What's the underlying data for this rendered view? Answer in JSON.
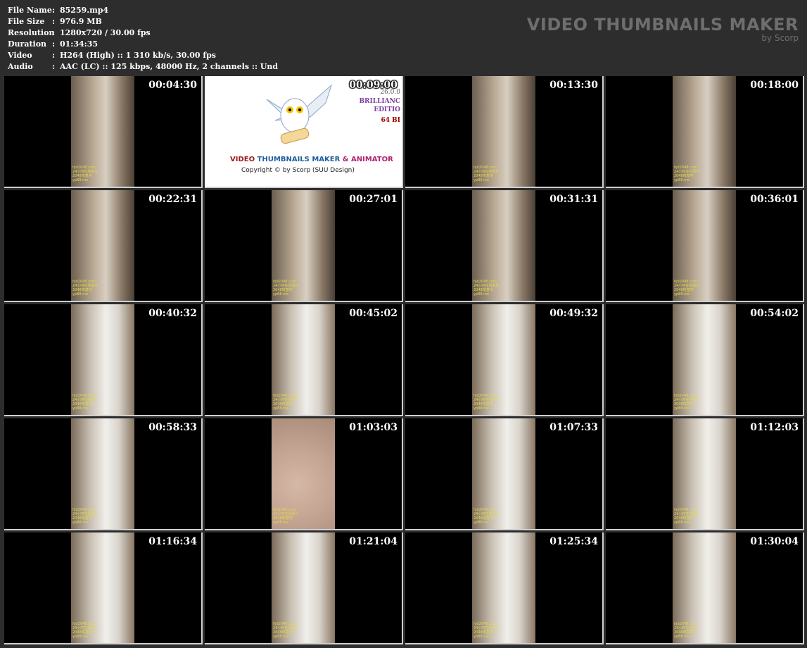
{
  "info": [
    {
      "label": "File Name",
      "value": "85259.mp4"
    },
    {
      "label": "File Size",
      "value": "976.9 MB"
    },
    {
      "label": "Resolution",
      "value": "1280x720 / 30.00 fps"
    },
    {
      "label": "Duration",
      "value": "01:34:35"
    },
    {
      "label": "Video",
      "value": "H264 (High) :: 1 310 kb/s, 30.00 fps"
    },
    {
      "label": "Audio",
      "value": "AAC (LC) :: 125 kbps, 48000 Hz, 2 channels :: Und"
    }
  ],
  "brand": {
    "title": "VIDEO THUMBNAILS MAKER",
    "subtitle": "by Scorp"
  },
  "colon": ":",
  "splash": {
    "title_a": "VIDEO",
    "title_b": " THUMBNAILS MAKER ",
    "title_c": "& ANIMATOR",
    "copyright": "Copyright © by Scorp (SUU Design)",
    "version": "26.0.0",
    "edition1": "BRILLIANC",
    "edition2": "EDITIO",
    "edition3": "64 BI"
  },
  "watermark": [
    "hjd2048.com",
    "24小时在线看片",
    "2048核基地",
    "yp88.me"
  ],
  "thumbnails": [
    {
      "time": "00:04:30",
      "kind": "room"
    },
    {
      "time": "00:09:00",
      "kind": "splash"
    },
    {
      "time": "00:13:30",
      "kind": "room"
    },
    {
      "time": "00:18:00",
      "kind": "room"
    },
    {
      "time": "00:22:31",
      "kind": "room"
    },
    {
      "time": "00:27:01",
      "kind": "room"
    },
    {
      "time": "00:31:31",
      "kind": "room"
    },
    {
      "time": "00:36:01",
      "kind": "room"
    },
    {
      "time": "00:40:32",
      "kind": "bed"
    },
    {
      "time": "00:45:02",
      "kind": "bed"
    },
    {
      "time": "00:49:32",
      "kind": "bed"
    },
    {
      "time": "00:54:02",
      "kind": "bed"
    },
    {
      "time": "00:58:33",
      "kind": "bed"
    },
    {
      "time": "01:03:03",
      "kind": "skin"
    },
    {
      "time": "01:07:33",
      "kind": "bed"
    },
    {
      "time": "01:12:03",
      "kind": "bed"
    },
    {
      "time": "01:16:34",
      "kind": "bed"
    },
    {
      "time": "01:21:04",
      "kind": "bed"
    },
    {
      "time": "01:25:34",
      "kind": "bed"
    },
    {
      "time": "01:30:04",
      "kind": "bed"
    }
  ]
}
